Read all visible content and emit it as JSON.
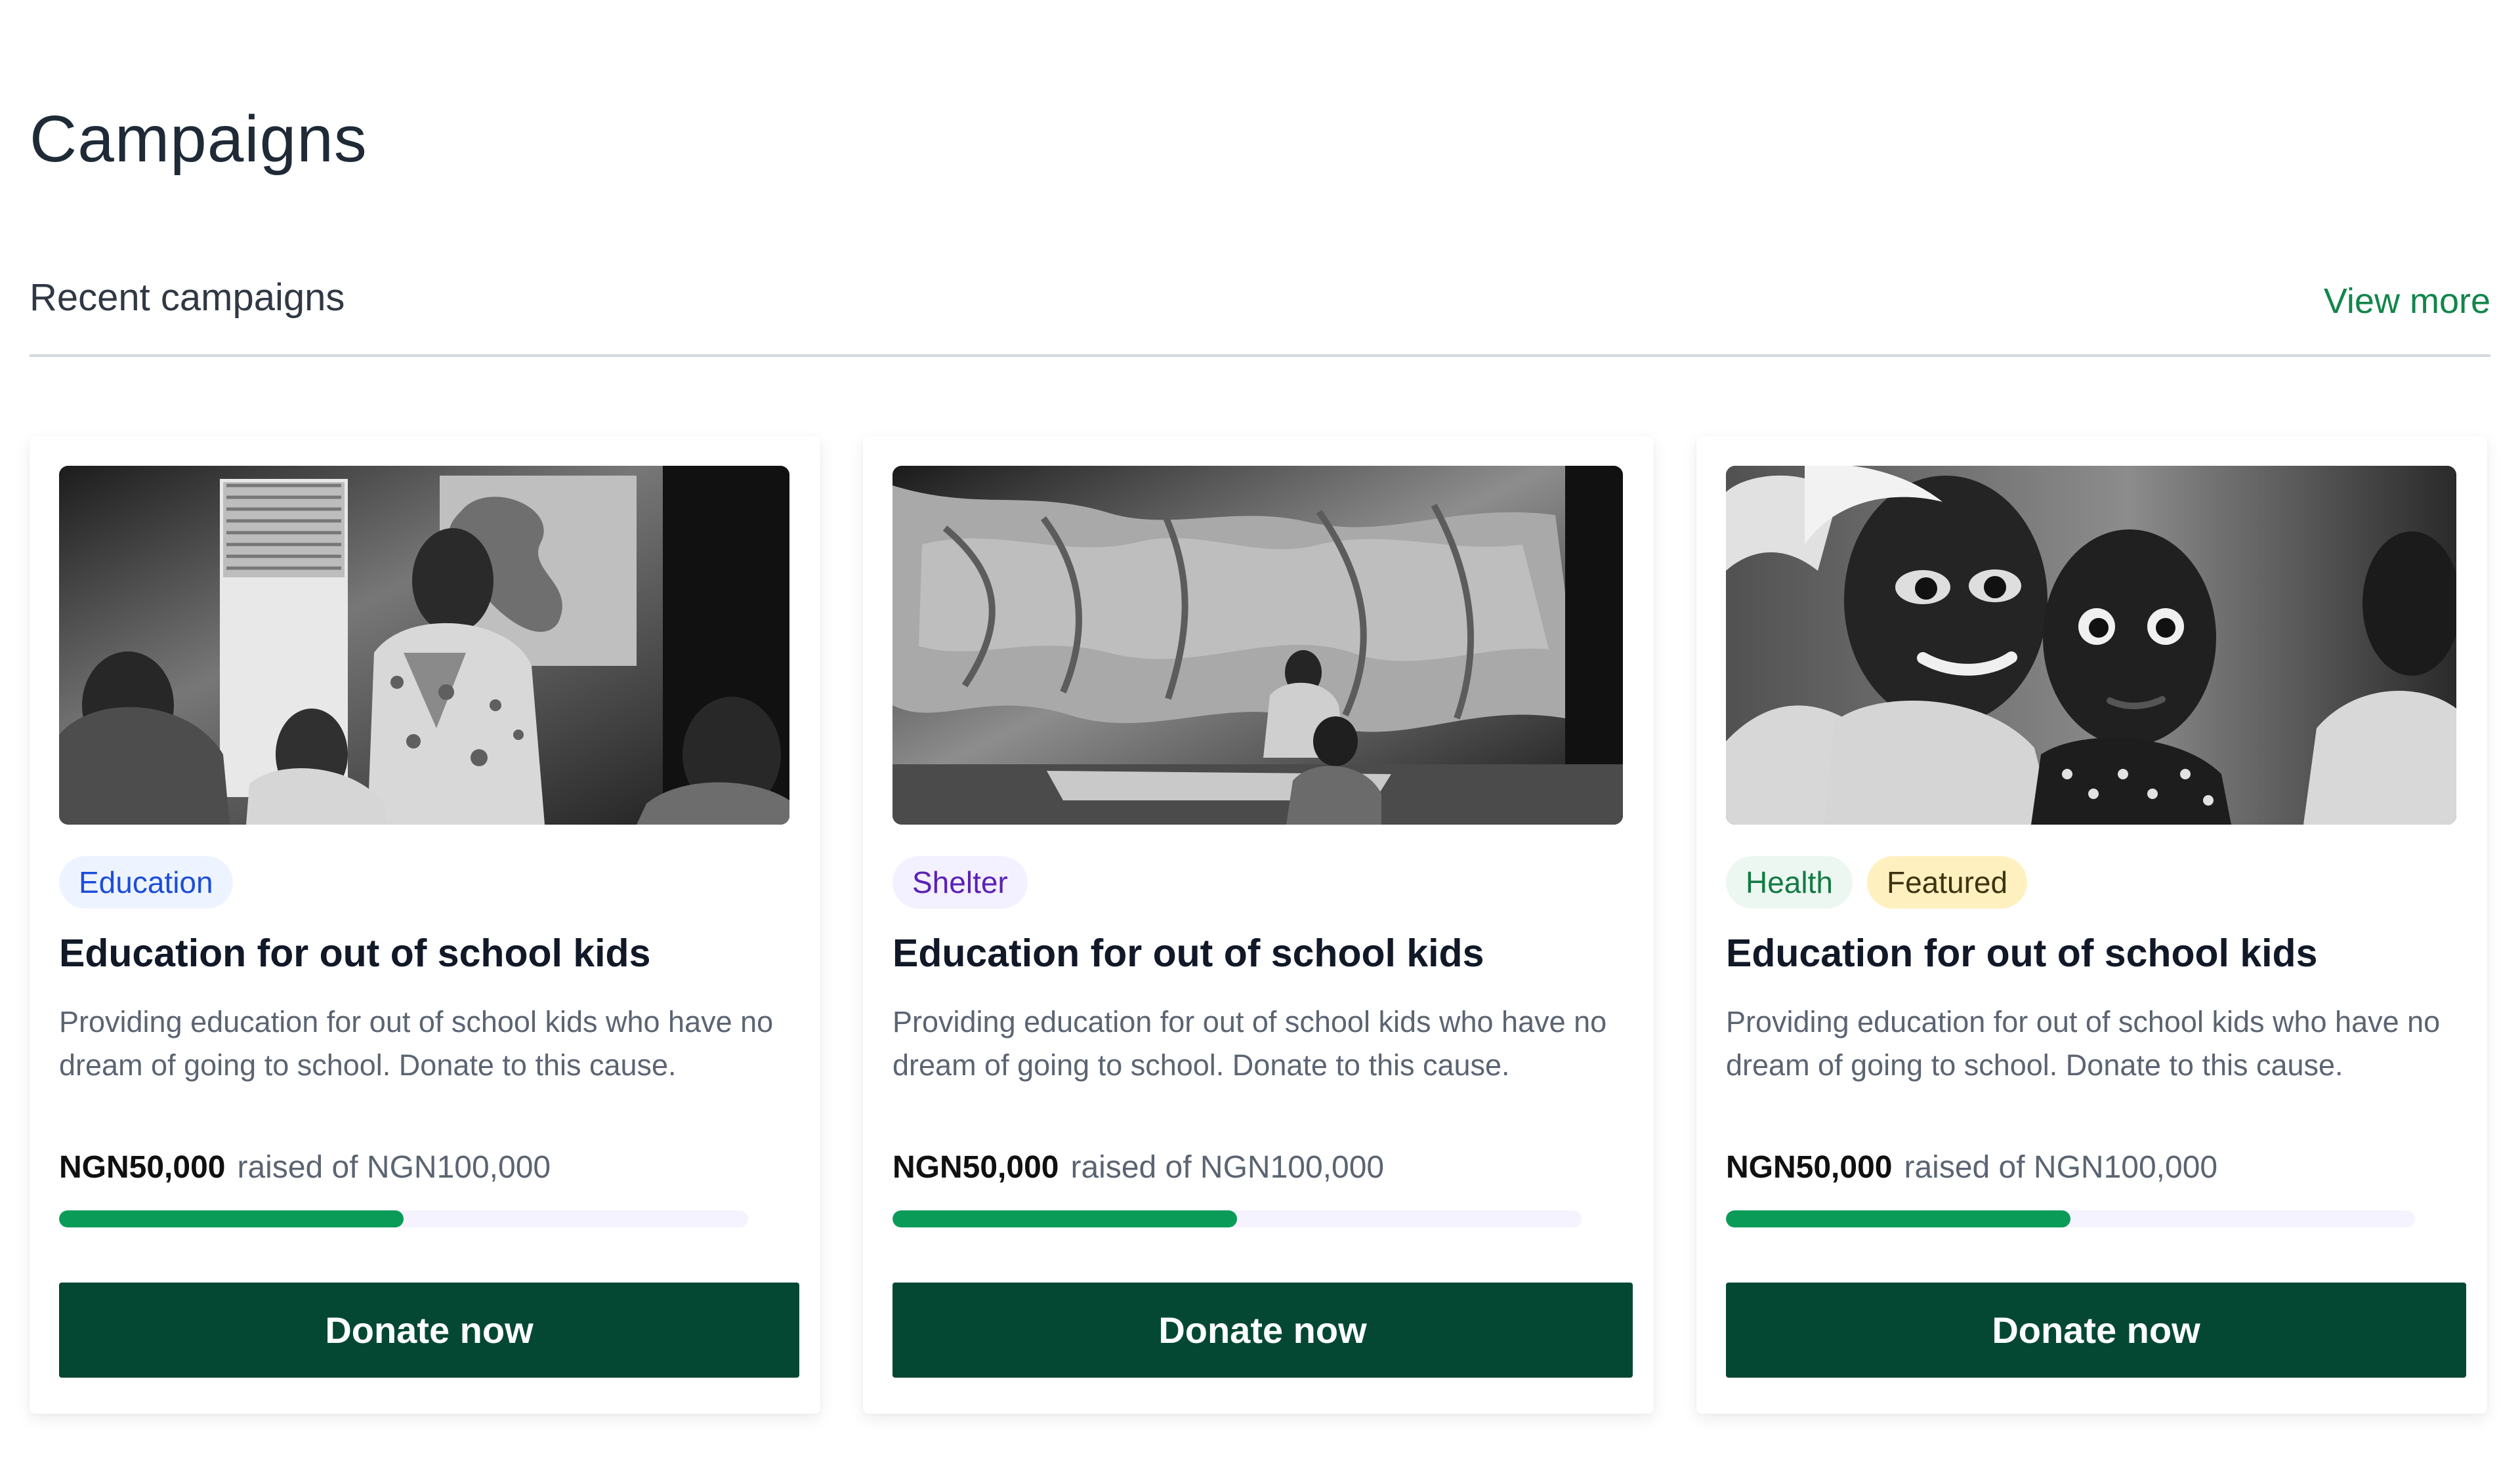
{
  "page": {
    "title": "Campaigns"
  },
  "section": {
    "title": "Recent campaigns",
    "view_more": "View more"
  },
  "campaigns": [
    {
      "image": "classroom-children-photo",
      "tags": [
        {
          "label": "Education",
          "color": "#1d4ed8",
          "background": "#eef4ff"
        }
      ],
      "title": "Education for out of school kids",
      "description": "Providing education for out of school kids who have no dream of going to school. Donate to this cause.",
      "raised_amount": "NGN50,000",
      "raised_of": "raised of NGN100,000",
      "progress": 0.5,
      "button": "Donate now"
    },
    {
      "image": "shelter-children-photo",
      "tags": [
        {
          "label": "Shelter",
          "color": "#5b21b6",
          "background": "#f3f0ff"
        }
      ],
      "title": "Education for out of school kids",
      "description": "Providing education for out of school kids who have no dream of going to school. Donate to this cause.",
      "raised_amount": "NGN50,000",
      "raised_of": "raised of NGN100,000",
      "progress": 0.5,
      "button": "Donate now"
    },
    {
      "image": "two-smiling-children-photo",
      "tags": [
        {
          "label": "Health",
          "color": "#137a45",
          "background": "#edf7f1"
        },
        {
          "label": "Featured",
          "color": "#3d3410",
          "background": "#fff1bf"
        }
      ],
      "title": "Education for out of school kids",
      "description": "Providing education for out of school kids who have no dream of going to school. Donate to this cause.",
      "raised_amount": "NGN50,000",
      "raised_of": "raised of NGN100,000",
      "progress": 0.5,
      "button": "Donate now"
    }
  ],
  "colors": {
    "accent": "#12854b",
    "button": "#044834",
    "progress": "#0b9b58",
    "progress_track": "#f5f3ff"
  }
}
